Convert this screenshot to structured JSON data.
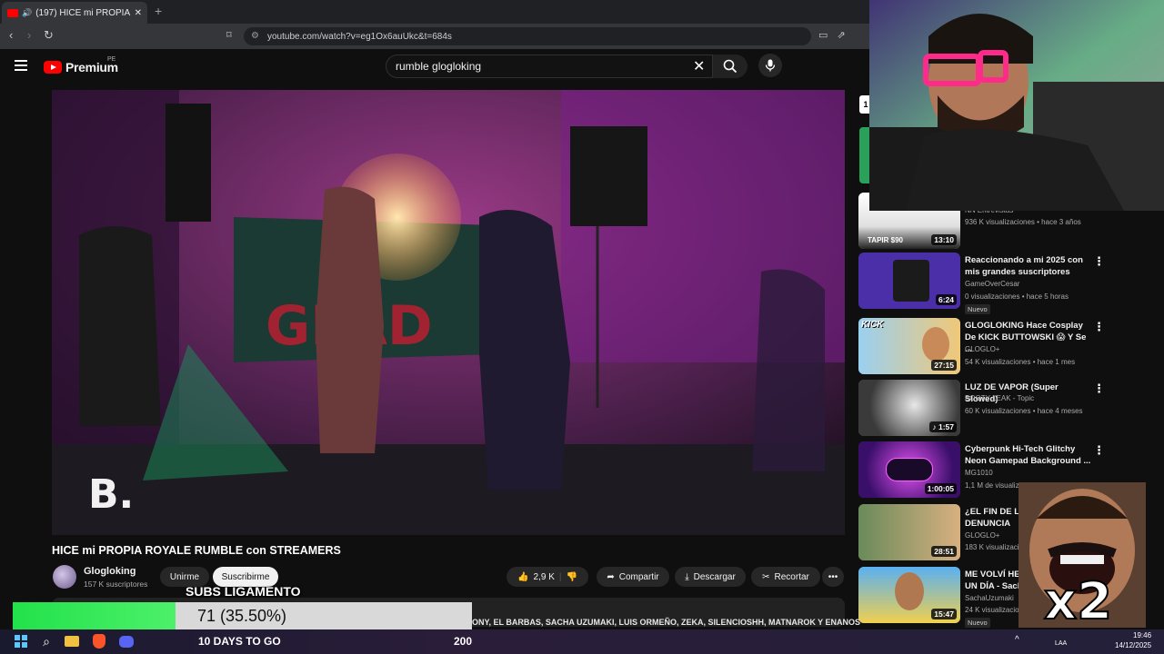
{
  "browser": {
    "tab_title": "(197) HICE mi PROPIA ROYAL",
    "new_tab": "+",
    "url": "youtube.com/watch?v=eg1Ox6auUkc&t=684s"
  },
  "youtube": {
    "logo": "Premium",
    "country_code": "PE",
    "search_value": "rumble glogloking"
  },
  "video": {
    "watermark": "B.",
    "title": "HICE mi PROPIA ROYALE RUMBLE con STREAMERS",
    "channel": "Glogloking",
    "subscribers": "157 K suscriptores",
    "join": "Unirme",
    "subscribe": "Suscribirme",
    "likes": "2,9 K",
    "share": "Compartir",
    "download": "Descargar",
    "clip": "Recortar",
    "description_snippet": "ONY, EL BARBAS, SACHA UZUMAKI, LUIS ORMEÑO, ZEKA, SILENCIOSHH, MATNAROK Y ENANOS"
  },
  "sidebar": {
    "items": [
      {
        "title": "",
        "channel": "NN Entrevistas",
        "meta": "936 K visualizaciones • hace 3 años",
        "duration": "13:10",
        "thumb_text": "TAPIR $90",
        "thumb_color": "#d9d9d9"
      },
      {
        "title": "Reaccionando a mi 2025 con mis grandes suscriptores",
        "channel": "GameOverCesar",
        "meta": "0 visualizaciones • hace 5 horas",
        "badge": "Nuevo",
        "duration": "6:24",
        "thumb_color": "#4b2fa8"
      },
      {
        "title": "GLOGLOKING Hace Cosplay De KICK BUTTOWSKI 😱 Y Se ...",
        "channel": "GLOGLO+",
        "meta": "54 K visualizaciones • hace 1 mes",
        "duration": "27:15",
        "thumb_text": "KICK",
        "thumb_color": "#5a8fd8"
      },
      {
        "title": "LUZ DE VAPOR (Super Slowed)",
        "channel": "BOOTY LEAK - Topic",
        "meta": "60 K visualizaciones • hace 4 meses",
        "duration": "♪ 1:57",
        "thumb_color": "#6b6b6b"
      },
      {
        "title": "Cyberpunk Hi-Tech Glitchy Neon Gamepad Background ...",
        "channel": "MG1010",
        "meta": "1,1 M de visualizaciones",
        "duration": "1:00:05",
        "thumb_color": "#6a1fa8"
      },
      {
        "title": "¿EL FIN DE LA HOUSE? DENUNCIA",
        "channel": "GLOGLO+",
        "meta": "183 K visualizaciones",
        "duration": "28:51",
        "thumb_color": "#8a6a4a"
      },
      {
        "title": "ME VOLVÍ HELADERO POR UN DÍA - Sachauzumaki",
        "channel": "SachaUzumaki",
        "meta": "24 K visualizaciones • hace",
        "badge": "Nuevo",
        "duration": "15:47",
        "thumb_color": "#3d8fd8"
      }
    ],
    "marker": "1"
  },
  "overlay": {
    "meme_text": "x2",
    "goal_label": "SUBS LIGAMENTO",
    "goal_progress": "71 (35.50%)",
    "goal_fraction": 0.355,
    "goal_target": "200",
    "countdown": "10 DAYS TO GO"
  },
  "taskbar": {
    "language": "LAA",
    "time": "19:46",
    "date": "14/12/2025"
  },
  "colors": {
    "accent": "#ff0000",
    "goal_fill": "#22e14a"
  }
}
